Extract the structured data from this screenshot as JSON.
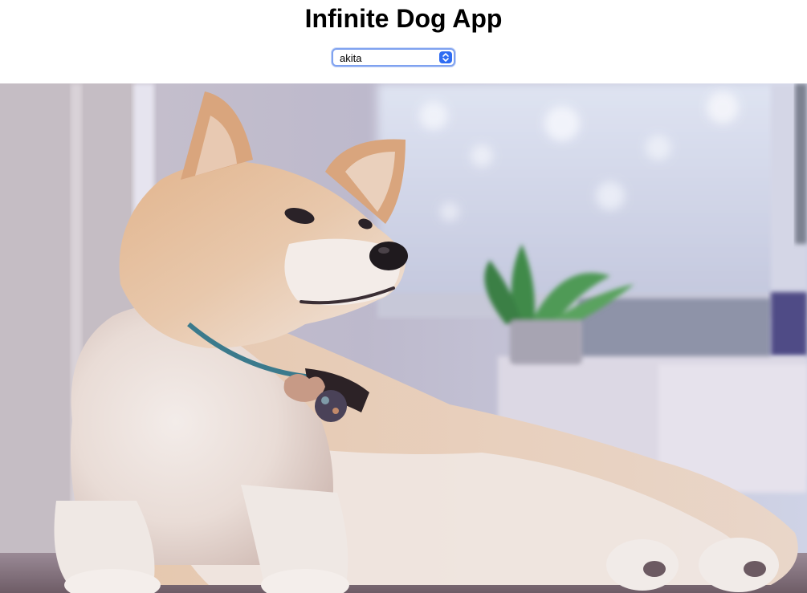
{
  "header": {
    "title": "Infinite Dog App"
  },
  "breed_select": {
    "selected": "akita",
    "icon": "chevron-up-down-icon",
    "accent_color": "#2f6cf2"
  },
  "dog_image": {
    "subject": "akita",
    "description_icon": "dog-photo"
  }
}
